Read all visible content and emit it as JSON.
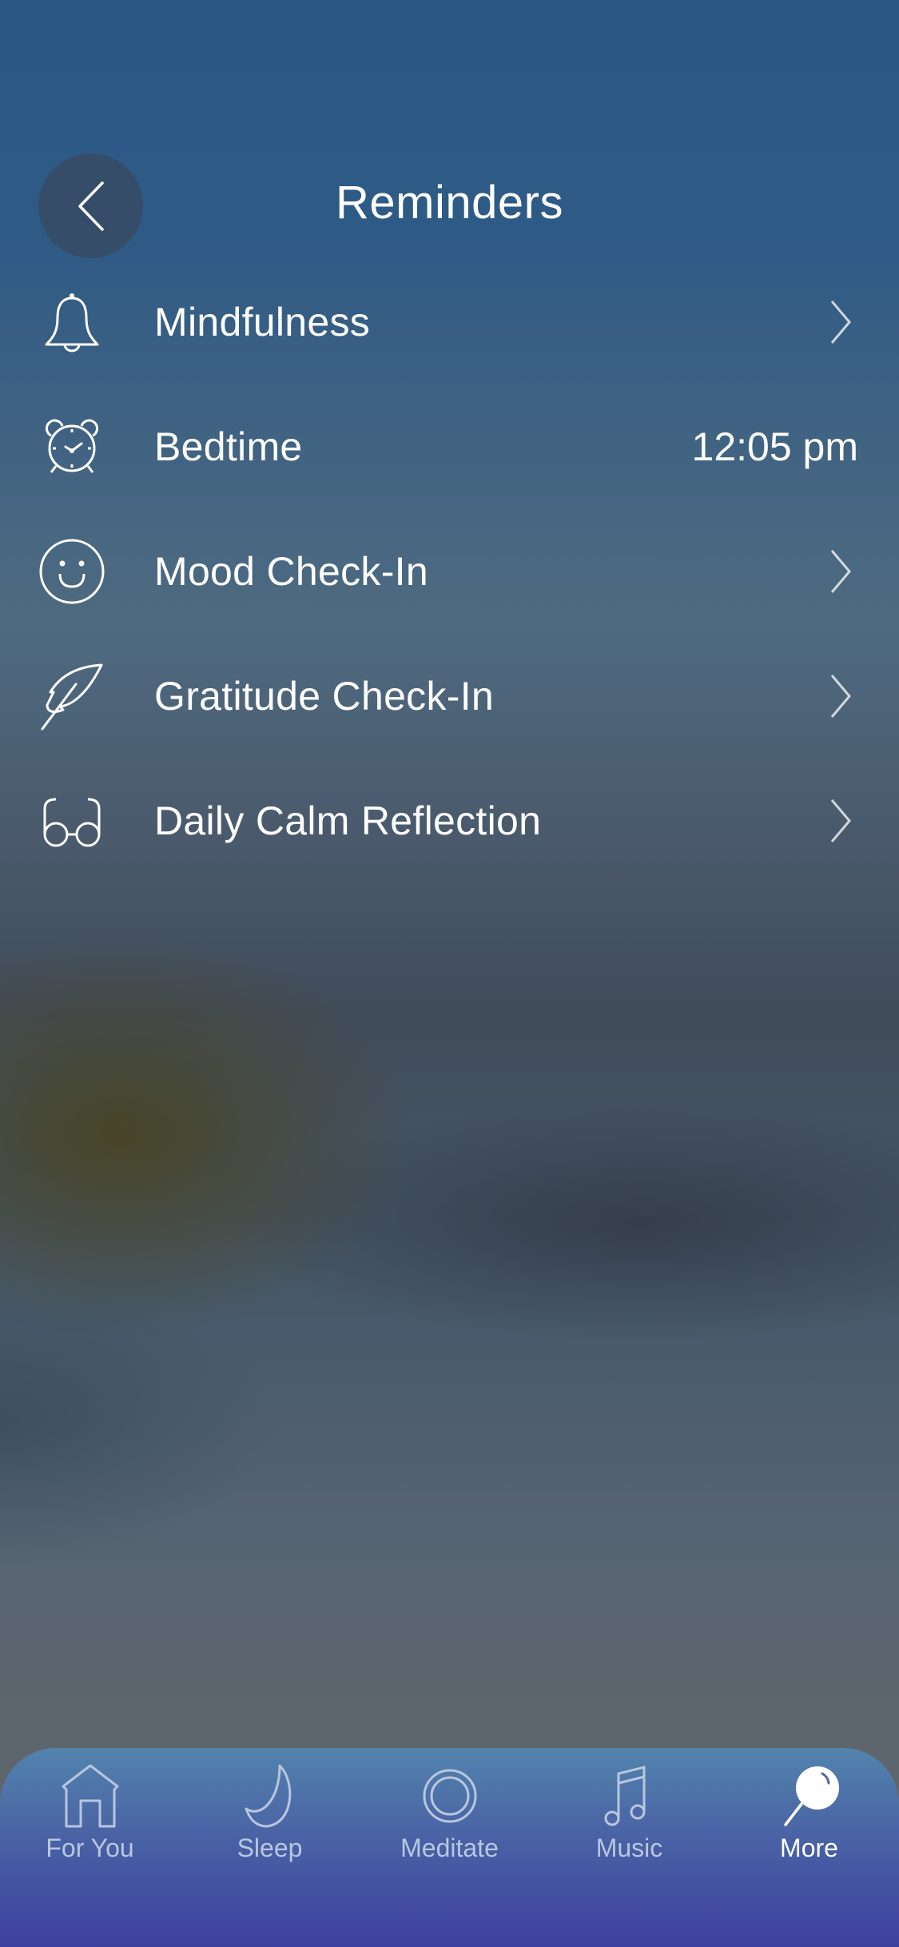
{
  "header": {
    "title": "Reminders",
    "back_icon": "chevron-left-icon"
  },
  "reminders": [
    {
      "label": "Mindfulness",
      "icon": "bell-icon",
      "trailing": "chevron"
    },
    {
      "label": "Bedtime",
      "icon": "alarm-clock-icon",
      "trailing": "value",
      "value": "12:05 pm"
    },
    {
      "label": "Mood Check-In",
      "icon": "smiley-face-icon",
      "trailing": "chevron"
    },
    {
      "label": "Gratitude Check-In",
      "icon": "feather-icon",
      "trailing": "chevron"
    },
    {
      "label": "Daily Calm Reflection",
      "icon": "glasses-icon",
      "trailing": "chevron"
    }
  ],
  "tabbar": {
    "tabs": [
      {
        "label": "For You",
        "icon": "house-icon",
        "active": false
      },
      {
        "label": "Sleep",
        "icon": "moon-icon",
        "active": false
      },
      {
        "label": "Meditate",
        "icon": "circle-icon",
        "active": false
      },
      {
        "label": "Music",
        "icon": "music-note-icon",
        "active": false
      },
      {
        "label": "More",
        "icon": "magnifier-icon",
        "active": true
      }
    ]
  },
  "colors": {
    "text": "#ffffff",
    "tab_inactive": "#b8c6e0",
    "tab_active": "#ffffff",
    "tabbar_top": "#5284ad",
    "tabbar_bottom": "#3f40a0"
  }
}
